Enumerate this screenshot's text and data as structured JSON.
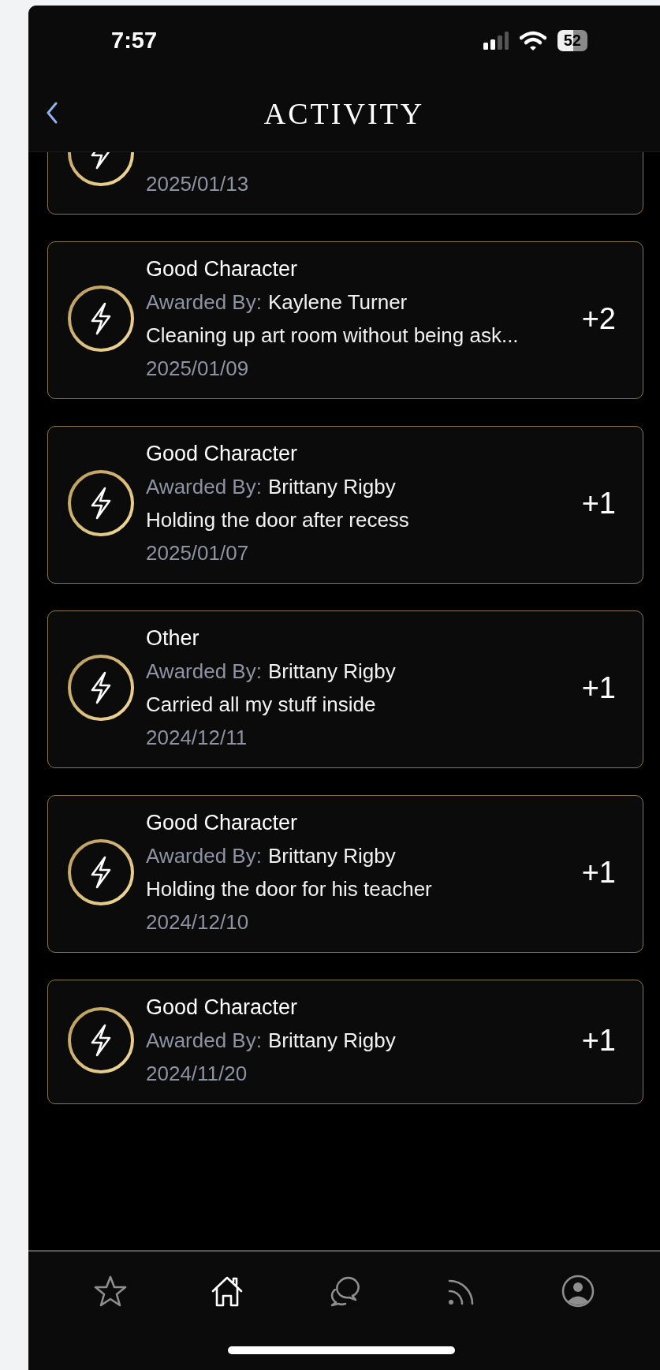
{
  "status_bar": {
    "time": "7:57",
    "battery": "52"
  },
  "header": {
    "title": "ACTIVITY"
  },
  "activities": [
    {
      "date": "2025/01/13"
    },
    {
      "title": "Good Character",
      "awarded_label": "Awarded By:",
      "awarded_by": "Kaylene Turner",
      "note": "Cleaning up art room without being ask...",
      "date": "2025/01/09",
      "points": "+2"
    },
    {
      "title": "Good Character",
      "awarded_label": "Awarded By:",
      "awarded_by": "Brittany Rigby",
      "note": "Holding the door after recess",
      "date": "2025/01/07",
      "points": "+1"
    },
    {
      "title": "Other",
      "awarded_label": "Awarded By:",
      "awarded_by": "Brittany Rigby",
      "note": "Carried all my stuff inside",
      "date": "2024/12/11",
      "points": "+1"
    },
    {
      "title": "Good Character",
      "awarded_label": "Awarded By:",
      "awarded_by": "Brittany Rigby",
      "note": "Holding the door for his teacher",
      "date": "2024/12/10",
      "points": "+1"
    },
    {
      "title": "Good Character",
      "awarded_label": "Awarded By:",
      "awarded_by": "Brittany Rigby",
      "date": "2024/11/20",
      "points": "+1"
    }
  ],
  "tab_bar": [
    {
      "kind": "star",
      "selected": false
    },
    {
      "kind": "home",
      "selected": true
    },
    {
      "kind": "chat",
      "selected": false
    },
    {
      "kind": "feed",
      "selected": false
    },
    {
      "kind": "profile",
      "selected": false
    }
  ]
}
